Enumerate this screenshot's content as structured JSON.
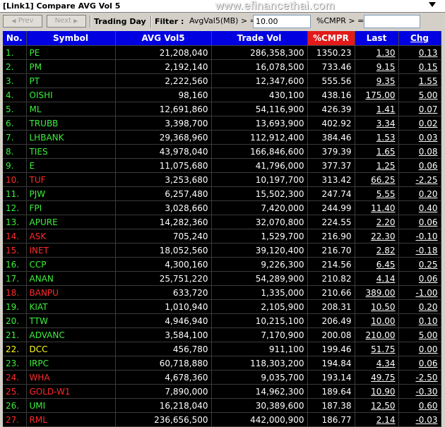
{
  "window": {
    "title": "[Link1] Compare AVG Vol 5",
    "watermark": "www.efinancethai.com"
  },
  "toolbar": {
    "prev_label": "Prev",
    "next_label": "Next",
    "trading_day_label": "Trading Day",
    "filter_label": "Filter :",
    "avgvol_label": "AvgVal5(MB) > =",
    "avgvol_value": "10.00",
    "cmpr_label": "%CMPR > =",
    "cmpr_value": ""
  },
  "table": {
    "headers": [
      "No.",
      "Symbol",
      "AVG Vol5",
      "Trade Vol",
      "%CMPR",
      "Last",
      "Chg"
    ],
    "rows": [
      {
        "no": "1.",
        "sym": "PE",
        "avg": "21,208,040",
        "trade": "286,358,300",
        "cmpr": "1350.23",
        "last": "1.30",
        "chg": "0.13",
        "c": "green"
      },
      {
        "no": "2.",
        "sym": "PM",
        "avg": "2,192,140",
        "trade": "16,078,500",
        "cmpr": "733.46",
        "last": "9.15",
        "chg": "0.15",
        "c": "green"
      },
      {
        "no": "3.",
        "sym": "PT",
        "avg": "2,222,560",
        "trade": "12,347,600",
        "cmpr": "555.56",
        "last": "9.35",
        "chg": "1.55",
        "c": "green"
      },
      {
        "no": "4.",
        "sym": "OISHI",
        "avg": "98,160",
        "trade": "430,100",
        "cmpr": "438.16",
        "last": "175.00",
        "chg": "5.00",
        "c": "green"
      },
      {
        "no": "5.",
        "sym": "ML",
        "avg": "12,691,860",
        "trade": "54,116,900",
        "cmpr": "426.39",
        "last": "1.41",
        "chg": "0.07",
        "c": "green"
      },
      {
        "no": "6.",
        "sym": "TRUBB",
        "avg": "3,398,700",
        "trade": "13,693,900",
        "cmpr": "402.92",
        "last": "3.34",
        "chg": "0.02",
        "c": "green"
      },
      {
        "no": "7.",
        "sym": "LHBANK",
        "avg": "29,368,960",
        "trade": "112,912,400",
        "cmpr": "384.46",
        "last": "1.53",
        "chg": "0.03",
        "c": "green"
      },
      {
        "no": "8.",
        "sym": "TIES",
        "avg": "43,978,040",
        "trade": "166,846,600",
        "cmpr": "379.39",
        "last": "1.65",
        "chg": "0.08",
        "c": "green"
      },
      {
        "no": "9.",
        "sym": "E",
        "avg": "11,075,680",
        "trade": "41,796,000",
        "cmpr": "377.37",
        "last": "1.25",
        "chg": "0.06",
        "c": "green"
      },
      {
        "no": "10.",
        "sym": "TUF",
        "avg": "3,253,680",
        "trade": "10,197,700",
        "cmpr": "313.42",
        "last": "66.25",
        "chg": "-2.25",
        "c": "red"
      },
      {
        "no": "11.",
        "sym": "PJW",
        "avg": "6,257,480",
        "trade": "15,502,300",
        "cmpr": "247.74",
        "last": "5.55",
        "chg": "0.20",
        "c": "green"
      },
      {
        "no": "12.",
        "sym": "FPI",
        "avg": "3,028,660",
        "trade": "7,420,000",
        "cmpr": "244.99",
        "last": "11.40",
        "chg": "0.40",
        "c": "green"
      },
      {
        "no": "13.",
        "sym": "APURE",
        "avg": "14,282,360",
        "trade": "32,070,800",
        "cmpr": "224.55",
        "last": "2.20",
        "chg": "0.06",
        "c": "green"
      },
      {
        "no": "14.",
        "sym": "ASK",
        "avg": "705,240",
        "trade": "1,529,700",
        "cmpr": "216.90",
        "last": "22.30",
        "chg": "-0.10",
        "c": "red"
      },
      {
        "no": "15.",
        "sym": "INET",
        "avg": "18,052,560",
        "trade": "39,120,400",
        "cmpr": "216.70",
        "last": "2.82",
        "chg": "-0.18",
        "c": "red"
      },
      {
        "no": "16.",
        "sym": "CCP",
        "avg": "4,300,160",
        "trade": "9,226,300",
        "cmpr": "214.56",
        "last": "6.45",
        "chg": "0.25",
        "c": "green"
      },
      {
        "no": "17.",
        "sym": "ANAN",
        "avg": "25,751,220",
        "trade": "54,289,900",
        "cmpr": "210.82",
        "last": "4.14",
        "chg": "0.06",
        "c": "green"
      },
      {
        "no": "18.",
        "sym": "BANPU",
        "avg": "633,720",
        "trade": "1,335,000",
        "cmpr": "210.66",
        "last": "389.00",
        "chg": "-1.00",
        "c": "red"
      },
      {
        "no": "19.",
        "sym": "KIAT",
        "avg": "1,010,940",
        "trade": "2,105,900",
        "cmpr": "208.31",
        "last": "10.50",
        "chg": "0.20",
        "c": "green"
      },
      {
        "no": "20.",
        "sym": "TTW",
        "avg": "4,946,940",
        "trade": "10,215,100",
        "cmpr": "206.49",
        "last": "10.00",
        "chg": "0.10",
        "c": "green"
      },
      {
        "no": "21.",
        "sym": "ADVANC",
        "avg": "3,584,100",
        "trade": "7,170,900",
        "cmpr": "200.08",
        "last": "210.00",
        "chg": "5.00",
        "c": "green"
      },
      {
        "no": "22.",
        "sym": "DCC",
        "avg": "456,780",
        "trade": "911,100",
        "cmpr": "199.46",
        "last": "51.75",
        "chg": "0.00",
        "c": "yellow"
      },
      {
        "no": "23.",
        "sym": "IRPC",
        "avg": "60,718,880",
        "trade": "118,303,200",
        "cmpr": "194.84",
        "last": "4.34",
        "chg": "0.06",
        "c": "green"
      },
      {
        "no": "24.",
        "sym": "WHA",
        "avg": "4,678,360",
        "trade": "9,035,700",
        "cmpr": "193.14",
        "last": "49.75",
        "chg": "-2.50",
        "c": "red"
      },
      {
        "no": "25.",
        "sym": "GOLD-W1",
        "avg": "7,890,000",
        "trade": "14,962,300",
        "cmpr": "189.64",
        "last": "10.90",
        "chg": "-0.30",
        "c": "red"
      },
      {
        "no": "26.",
        "sym": "UMI",
        "avg": "16,218,040",
        "trade": "30,389,600",
        "cmpr": "187.38",
        "last": "12.50",
        "chg": "0.60",
        "c": "green"
      },
      {
        "no": "27.",
        "sym": "RML",
        "avg": "236,656,500",
        "trade": "442,000,900",
        "cmpr": "186.77",
        "last": "2.14",
        "chg": "-0.03",
        "c": "red"
      }
    ]
  }
}
